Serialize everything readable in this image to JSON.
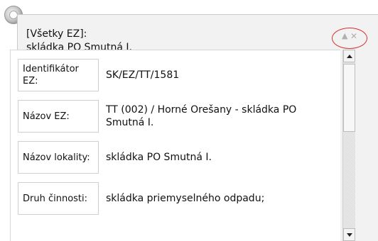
{
  "popup": {
    "header_line1": "[Všetky EZ]:",
    "header_line2": "skládka PO Smutná I.",
    "minimize_glyph": "▲",
    "close_glyph": "✕"
  },
  "rows": [
    {
      "label": "Identifikátor EZ:",
      "value": "SK/EZ/TT/1581"
    },
    {
      "label": "Názov EZ:",
      "value": "TT (002) / Horné Orešany - skládka PO Smutná I."
    },
    {
      "label": "Názov lokality:",
      "value": "skládka PO Smutná I."
    },
    {
      "label": "Druh činnosti:",
      "value": "skládka priemyselného odpadu;"
    }
  ],
  "icons": {
    "map_marker": "map-marker-icon",
    "minimize": "minimize-icon",
    "close": "close-icon",
    "scroll_up": "scroll-up-icon",
    "scroll_down": "scroll-down-icon"
  },
  "colors": {
    "annotation_ellipse": "#d8322f",
    "popup_background": "#f2f2f2",
    "control_icons": "#b0b0b0"
  }
}
